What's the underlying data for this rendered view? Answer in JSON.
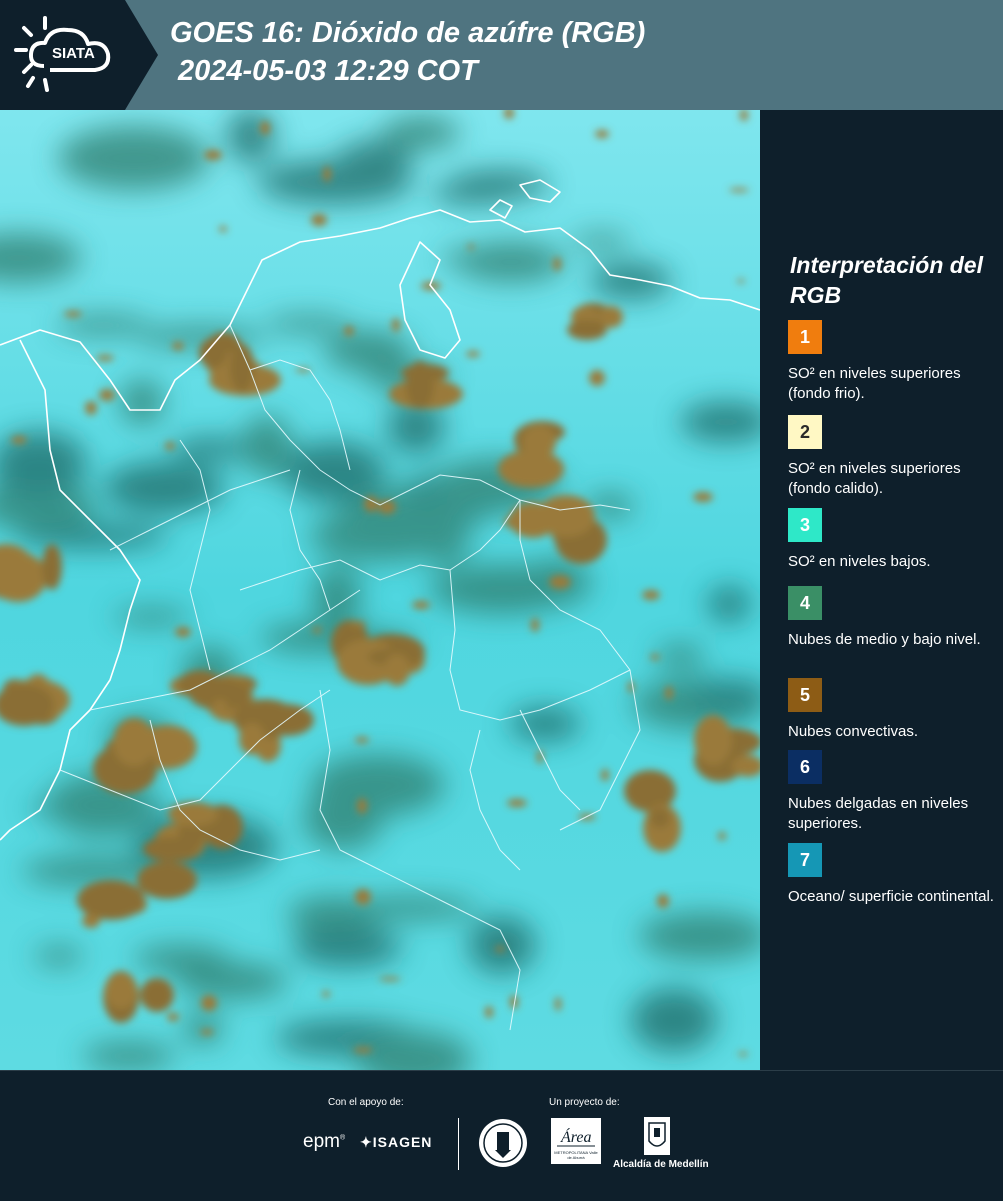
{
  "header": {
    "logo_text": "SIATA",
    "title_line1": "GOES 16: Dióxido de azúfre (RGB)",
    "title_line2": "2024-05-03 12:29 COT"
  },
  "legend": {
    "title": "Interpretación del RGB",
    "items": [
      {
        "number": "1",
        "color": "#f07d0e",
        "text": "SO² en niveles superiores (fondo frio)."
      },
      {
        "number": "2",
        "color": "#fff8c4",
        "text": "SO² en niveles superiores (fondo calido)."
      },
      {
        "number": "3",
        "color": "#2ee8c8",
        "text": "SO² en niveles bajos."
      },
      {
        "number": "4",
        "color": "#3a8f66",
        "text": "Nubes de medio y bajo nivel."
      },
      {
        "number": "5",
        "color": "#8d5c15",
        "text": "Nubes convectivas."
      },
      {
        "number": "6",
        "color": "#0b2e63",
        "text": "Nubes delgadas en niveles superiores."
      },
      {
        "number": "7",
        "color": "#1597b5",
        "text": "Oceano/ superficie continental."
      }
    ]
  },
  "footer": {
    "support_label": "Con el apoyo de:",
    "project_label": "Un proyecto de:",
    "sponsors": [
      "epm",
      "ISAGEN"
    ],
    "partners": [
      "METROPOLITANA Valle de Aburrá",
      "Alcaldía de Medellín"
    ]
  },
  "colors": {
    "header_bg": "#4f7480",
    "logo_bg": "#0e1f2b",
    "page_bg": "#0e1f2b",
    "map_base": "#49d3dc",
    "cloud_convective": "#9a7a3a",
    "cloud_low": "#2f7f70"
  }
}
